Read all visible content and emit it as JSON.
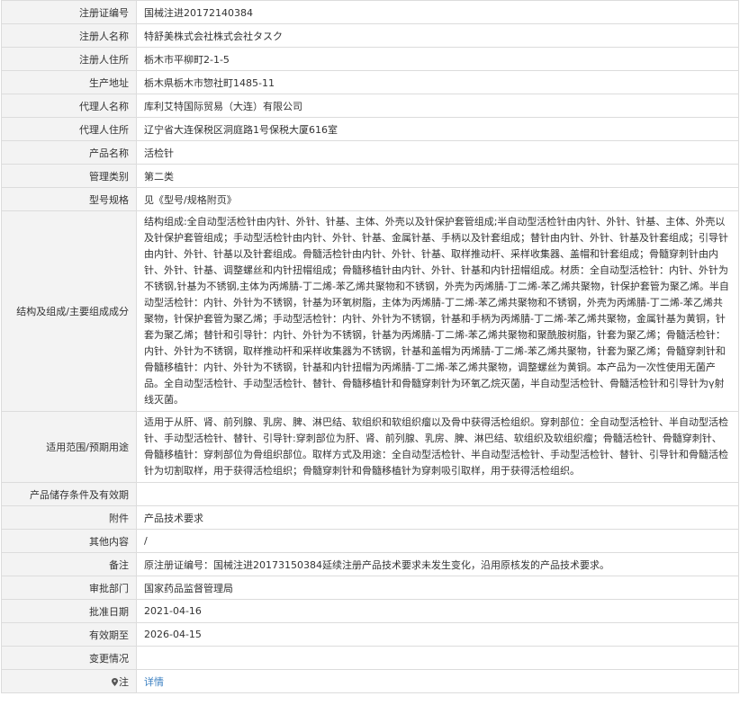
{
  "rows": [
    {
      "label": "注册证编号",
      "value": "国械注进20172140384"
    },
    {
      "label": "注册人名称",
      "value": "特舒美株式会社株式会社タスク"
    },
    {
      "label": "注册人住所",
      "value": "栃木市平柳町2-1-5"
    },
    {
      "label": "生产地址",
      "value": "栃木県栃木市惣社町1485-11"
    },
    {
      "label": "代理人名称",
      "value": "库利艾特国际贸易（大连）有限公司"
    },
    {
      "label": "代理人住所",
      "value": "辽宁省大连保税区洞庭路1号保税大厦616室"
    },
    {
      "label": "产品名称",
      "value": "活检针"
    },
    {
      "label": "管理类别",
      "value": "第二类"
    },
    {
      "label": "型号规格",
      "value": "见《型号/规格附页》"
    },
    {
      "label": "结构及组成/主要组成成分",
      "value": "结构组成:全自动型活检针由内针、外针、针基、主体、外壳以及针保护套管组成;半自动型活检针由内针、外针、针基、主体、外壳以及针保护套管组成；手动型活检针由内针、外针、针基、金属针基、手柄以及针套组成；替针由内针、外针、针基及针套组成；引导针由内针、外针、针基以及针套组成。骨髓活检针由内针、外针、针基、取样推动杆、采样收集器、盖帽和针套组成；骨髓穿刺针由内针、外针、针基、调整螺丝和内针扭帽组成；骨髓移植针由内针、外针、针基和内针扭帽组成。材质：全自动型活检针：内针、外针为不锈钢,针基为不锈钢,主体为丙烯腈-丁二烯-苯乙烯共聚物和不锈钢，外壳为丙烯腈-丁二烯-苯乙烯共聚物，针保护套管为聚乙烯。半自动型活检针：内针、外针为不锈钢，针基为环氧树脂，主体为丙烯腈-丁二烯-苯乙烯共聚物和不锈钢，外壳为丙烯腈-丁二烯-苯乙烯共聚物，针保护套管为聚乙烯；手动型活检针：内针、外针为不锈钢，针基和手柄为丙烯腈-丁二烯-苯乙烯共聚物，金属针基为黄铜，针套为聚乙烯；替针和引导针：内针、外针为不锈钢，针基为丙烯腈-丁二烯-苯乙烯共聚物和聚酰胺树脂，针套为聚乙烯；骨髓活检针：内针、外针为不锈钢，取样推动杆和采样收集器为不锈钢，针基和盖帽为丙烯腈-丁二烯-苯乙烯共聚物，针套为聚乙烯；骨髓穿刺针和骨髓移植针：内针、外针为不锈钢，针基和内针扭帽为丙烯腈-丁二烯-苯乙烯共聚物，调整螺丝为黄铜。本产品为一次性使用无菌产品。全自动型活检针、手动型活检针、替针、骨髓移植针和骨髓穿刺针为环氧乙烷灭菌，半自动型活检针、骨髓活检针和引导针为γ射线灭菌。"
    },
    {
      "label": "适用范围/预期用途",
      "value": "适用于从肝、肾、前列腺、乳房、脾、淋巴结、软组织和软组织瘤以及骨中获得活检组织。穿刺部位：全自动型活检针、半自动型活检针、手动型活检针、替针、引导针:穿刺部位为肝、肾、前列腺、乳房、脾、淋巴结、软组织及软组织瘤；骨髓活检针、骨髓穿刺针、骨髓移植针：穿刺部位为骨组织部位。取样方式及用途：全自动型活检针、半自动型活检针、手动型活检针、替针、引导针和骨髓活检针为切割取样，用于获得活检组织；骨髓穿刺针和骨髓移植针为穿刺吸引取样，用于获得活检组织。"
    },
    {
      "label": "产品储存条件及有效期",
      "value": ""
    },
    {
      "label": "附件",
      "value": "产品技术要求"
    },
    {
      "label": "其他内容",
      "value": "/"
    },
    {
      "label": "备注",
      "value": "原注册证编号：国械注进20173150384延续注册产品技术要求未发生变化，沿用原核发的产品技术要求。"
    },
    {
      "label": "审批部门",
      "value": "国家药品监督管理局"
    },
    {
      "label": "批准日期",
      "value": "2021-04-16"
    },
    {
      "label": "有效期至",
      "value": "2026-04-15"
    },
    {
      "label": "变更情况",
      "value": ""
    }
  ],
  "note_row": {
    "label": "注",
    "link_text": "详情",
    "icon": "map-pin-icon"
  },
  "colors": {
    "border": "#dcdcdc",
    "label_bg": "#f3f3f3",
    "link": "#3a7fc1",
    "text": "#333333"
  }
}
